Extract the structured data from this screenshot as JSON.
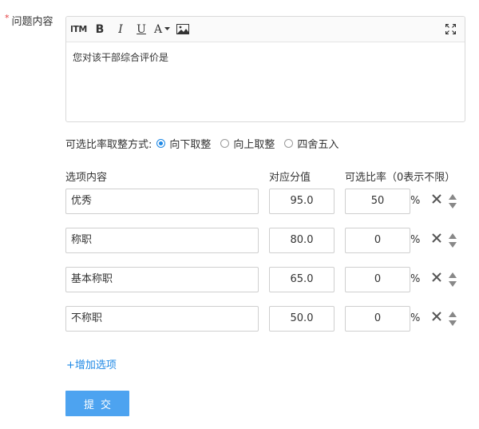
{
  "question": {
    "required_mark": "*",
    "label": "问题内容",
    "content": "您对该干部综合评价是"
  },
  "toolbar": {
    "html": "HTML",
    "bold": "B",
    "italic": "I",
    "underline": "U",
    "font_color": "A",
    "icons": [
      "html-icon",
      "bold-icon",
      "italic-icon",
      "underline-icon",
      "font-color-icon",
      "image-icon",
      "fullscreen-icon"
    ]
  },
  "rounding": {
    "title": "可选比率取整方式:",
    "options": [
      {
        "label": "向下取整",
        "selected": true
      },
      {
        "label": "向上取整",
        "selected": false
      },
      {
        "label": "四舍五入",
        "selected": false
      }
    ]
  },
  "headers": {
    "content": "选项内容",
    "score": "对应分值",
    "rate": "可选比率（0表示不限）"
  },
  "options": [
    {
      "name": "优秀",
      "score": "95.0",
      "rate": "50",
      "unit": "%"
    },
    {
      "name": "称职",
      "score": "80.0",
      "rate": "0",
      "unit": "%"
    },
    {
      "name": "基本称职",
      "score": "65.0",
      "rate": "0",
      "unit": "%"
    },
    {
      "name": "不称职",
      "score": "50.0",
      "rate": "0",
      "unit": "%"
    }
  ],
  "add_option": "+增加选项",
  "submit": "提交",
  "colors": {
    "accent": "#1e88e5",
    "button": "#4da3f0",
    "required": "#e4393c"
  }
}
